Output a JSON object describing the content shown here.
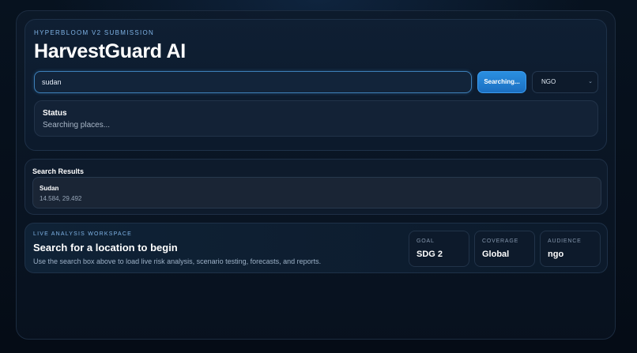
{
  "header": {
    "eyebrow": "HYPERBLOOM V2 SUBMISSION",
    "title": "HarvestGuard AI"
  },
  "search": {
    "value": "sudan",
    "button_label": "Searching...",
    "role_selected": "NGO"
  },
  "status": {
    "label": "Status",
    "text": "Searching places..."
  },
  "results": {
    "title": "Search Results",
    "items": [
      {
        "name": "Sudan",
        "coords": "14.584, 29.492"
      }
    ]
  },
  "workspace": {
    "eyebrow": "LIVE ANALYSIS WORKSPACE",
    "heading": "Search for a location to begin",
    "subtext": "Use the search box above to load live risk analysis, scenario testing, forecasts, and reports.",
    "stats": [
      {
        "label": "GOAL",
        "value": "SDG 2"
      },
      {
        "label": "COVERAGE",
        "value": "Global"
      },
      {
        "label": "AUDIENCE",
        "value": "ngo"
      }
    ]
  }
}
